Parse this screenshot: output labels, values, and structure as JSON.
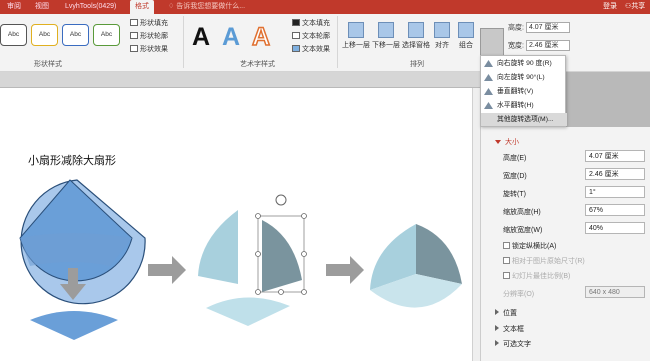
{
  "tabs": [
    "审阅",
    "视图",
    "LvyhTools(0429)",
    "格式"
  ],
  "tell_me": "告诉我您想要做什么...",
  "login": "登录",
  "share": "共享",
  "ribbon": {
    "shape_styles": [
      "Abc",
      "Abc",
      "Abc",
      "Abc"
    ],
    "shape_fill": "形状填充",
    "shape_outline": "形状轮廓",
    "shape_effect": "形状效果",
    "group_shape_styles": "形状样式",
    "wordart": [
      "A",
      "A",
      "A"
    ],
    "text_fill": "文本填充",
    "text_outline": "文本轮廓",
    "text_effect": "文本效果",
    "group_wordart": "艺术字样式",
    "bring_forward": "上移一层",
    "send_backward": "下移一层",
    "selection_pane": "选择窗格",
    "align": "对齐",
    "group": "组合",
    "rotate": "旋转",
    "group_arrange": "排列",
    "height_label": "高度:",
    "height_value": "4.07 厘米",
    "width_label": "宽度:",
    "width_value": "2.46 厘米"
  },
  "rotate_menu": [
    "向右旋转 90 度(R)",
    "向左旋转 90°(L)",
    "垂直翻转(V)",
    "水平翻转(H)",
    "其他旋转选项(M)..."
  ],
  "slide": {
    "title": "小扇形减除大扇形"
  },
  "pane": {
    "size_section": "大小",
    "height_label": "高度(E)",
    "height_value": "4.07 厘米",
    "width_label": "宽度(D)",
    "width_value": "2.46 厘米",
    "rotation_label": "旋转(T)",
    "rotation_value": "1°",
    "scale_height_label": "缩放高度(H)",
    "scale_height_value": "67%",
    "scale_width_label": "缩放宽度(W)",
    "scale_width_value": "40%",
    "lock_ratio": "锁定纵横比(A)",
    "relative_to_original": "相对于图片原始尺寸(R)",
    "best_scale": "幻灯片最佳比例(B)",
    "resolution_label": "分辨率(O)",
    "resolution_value": "640 x 480",
    "position_section": "位置",
    "textbox_section": "文本框",
    "alt_text_section": "可选文字"
  },
  "colors": {
    "accent": "#c0392b",
    "shape_light": "#a9c8eb",
    "shape_mid": "#6a9fd8",
    "shape_teal_light": "#a8d0dd",
    "shape_teal_dark": "#7a949e",
    "arrow_gray": "#9c9c9c"
  }
}
